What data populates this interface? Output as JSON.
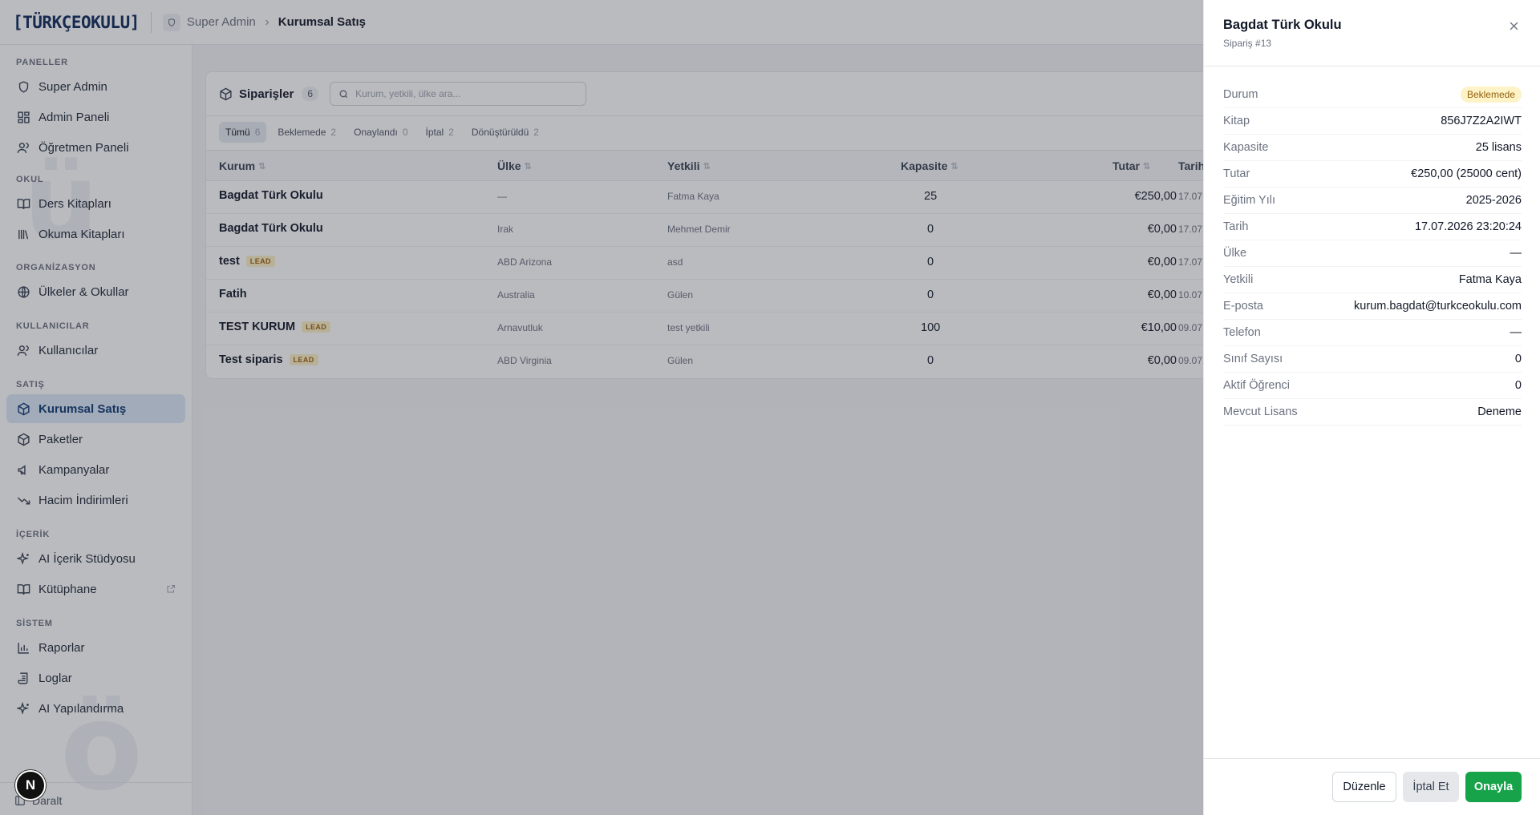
{
  "header": {
    "logo": "[TÜRKÇEOKULU]",
    "breadcrumb": {
      "parent": "Super Admin",
      "current": "Kurumsal Satış"
    }
  },
  "sidebar": {
    "sections": [
      {
        "label": "PANELLER"
      },
      {
        "label": "OKUL"
      },
      {
        "label": "ORGANİZASYON"
      },
      {
        "label": "KULLANICILAR"
      },
      {
        "label": "SATIŞ"
      },
      {
        "label": "İÇERİK"
      },
      {
        "label": "SİSTEM"
      }
    ],
    "items": [
      {
        "label": "Super Admin",
        "icon": "shield-icon"
      },
      {
        "label": "Admin Paneli",
        "icon": "grid-icon"
      },
      {
        "label": "Öğretmen Paneli",
        "icon": "users-icon"
      },
      {
        "label": "Ders Kitapları",
        "icon": "book-open-icon"
      },
      {
        "label": "Okuma Kitapları",
        "icon": "library-icon"
      },
      {
        "label": "Ülkeler & Okullar",
        "icon": "globe-icon"
      },
      {
        "label": "Kullanıcılar",
        "icon": "users-icon"
      },
      {
        "label": "Kurumsal Satış",
        "icon": "package-icon"
      },
      {
        "label": "Paketler",
        "icon": "package-icon"
      },
      {
        "label": "Kampanyalar",
        "icon": "megaphone-icon"
      },
      {
        "label": "Hacim İndirimleri",
        "icon": "trending-down-icon"
      },
      {
        "label": "AI İçerik Stüdyosu",
        "icon": "sparkles-icon"
      },
      {
        "label": "Kütüphane",
        "icon": "book-open-icon"
      },
      {
        "label": "Raporlar",
        "icon": "bar-chart-icon"
      },
      {
        "label": "Loglar",
        "icon": "scroll-icon"
      },
      {
        "label": "AI Yapılandırma",
        "icon": "sparkles-icon"
      }
    ],
    "collapse_label": "Daralt",
    "dev_badge": "N"
  },
  "orders": {
    "title": "Siparişler",
    "count": "6",
    "search_placeholder": "Kurum, yetkili, ülke ara...",
    "tabs": [
      {
        "label": "Tümü",
        "count": "6"
      },
      {
        "label": "Beklemede",
        "count": "2"
      },
      {
        "label": "Onaylandı",
        "count": "0"
      },
      {
        "label": "İptal",
        "count": "2"
      },
      {
        "label": "Dönüştürüldü",
        "count": "2"
      }
    ],
    "columns": [
      "Kurum",
      "Ülke",
      "Yetkili",
      "Kapasite",
      "Tutar",
      "Tarih"
    ],
    "rows": [
      {
        "kurum": "Bagdat Türk Okulu",
        "lead": "",
        "ulke": "—",
        "yetkili": "Fatma Kaya",
        "kapasite": "25",
        "tutar": "€250,00",
        "tarih": "17.07."
      },
      {
        "kurum": "Bagdat Türk Okulu",
        "lead": "",
        "ulke": "Irak",
        "yetkili": "Mehmet Demir",
        "kapasite": "0",
        "tutar": "€0,00",
        "tarih": "17.07."
      },
      {
        "kurum": "test",
        "lead": "LEAD",
        "ulke": "ABD Arizona",
        "yetkili": "asd",
        "kapasite": "0",
        "tutar": "€0,00",
        "tarih": "17.07."
      },
      {
        "kurum": "Fatih",
        "lead": "",
        "ulke": "Australia",
        "yetkili": "Gülen",
        "kapasite": "0",
        "tutar": "€0,00",
        "tarih": "10.07."
      },
      {
        "kurum": "TEST KURUM",
        "lead": "LEAD",
        "ulke": "Arnavutluk",
        "yetkili": "test yetkili",
        "kapasite": "100",
        "tutar": "€10,00",
        "tarih": "09.07."
      },
      {
        "kurum": "Test siparis",
        "lead": "LEAD",
        "ulke": "ABD Virginia",
        "yetkili": "Gülen",
        "kapasite": "0",
        "tutar": "€0,00",
        "tarih": "09.07."
      }
    ]
  },
  "drawer": {
    "title": "Bagdat Türk Okulu",
    "subtitle": "Sipariş #13",
    "status": {
      "label": "Durum",
      "value": "Beklemede"
    },
    "details": [
      {
        "label": "Kitap",
        "value": "856J7Z2A2IWT"
      },
      {
        "label": "Kapasite",
        "value": "25 lisans"
      },
      {
        "label": "Tutar",
        "value": "€250,00 (25000 cent)"
      },
      {
        "label": "Eğitim Yılı",
        "value": "2025-2026"
      },
      {
        "label": "Tarih",
        "value": "17.07.2026 23:20:24"
      },
      {
        "label": "Ülke",
        "value": "—"
      },
      {
        "label": "Yetkili",
        "value": "Fatma Kaya"
      },
      {
        "label": "E-posta",
        "value": "kurum.bagdat@turkceokulu.com"
      },
      {
        "label": "Telefon",
        "value": "—"
      },
      {
        "label": "Sınıf Sayısı",
        "value": "0"
      },
      {
        "label": "Aktif Öğrenci",
        "value": "0"
      },
      {
        "label": "Mevcut Lisans",
        "value": "Deneme"
      }
    ],
    "buttons": {
      "edit": "Düzenle",
      "cancel": "İptal Et",
      "approve": "Onayla"
    }
  },
  "colors": {
    "brand": "#0f2a5c",
    "active_nav_bg": "#dbe7f7",
    "approve": "#16a34a",
    "pending_badge": "#fdf3c7",
    "lead_badge": "#fdf0c8"
  }
}
